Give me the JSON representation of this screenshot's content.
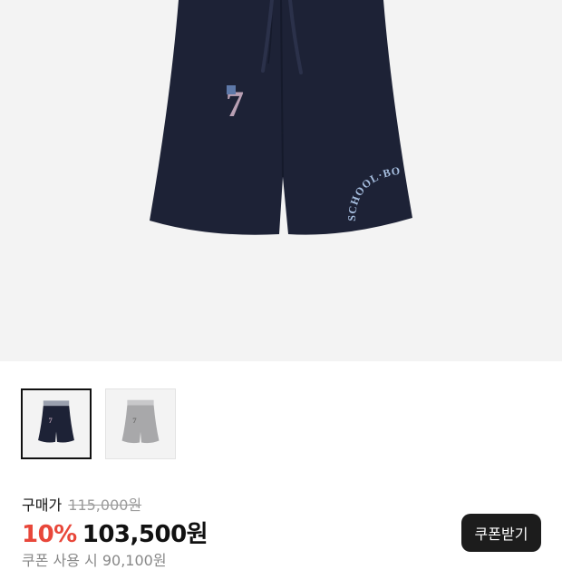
{
  "product": {
    "image_alt": "product-image-navy-shorts",
    "graphic_number": "7",
    "graphic_arc_text": "SCHOOL·BOY",
    "colors": {
      "navy": "#1d2236",
      "grey": "#a8a8aa",
      "accent": "#e8473a"
    }
  },
  "thumbnails": [
    {
      "name": "navy",
      "selected": true
    },
    {
      "name": "grey",
      "selected": false
    }
  ],
  "price": {
    "label": "구매가",
    "original": "115,000원",
    "discount": "10%",
    "sale": "103,500원",
    "coupon_note": "쿠폰 사용 시 90,100원",
    "coupon_button": "쿠폰받기"
  }
}
